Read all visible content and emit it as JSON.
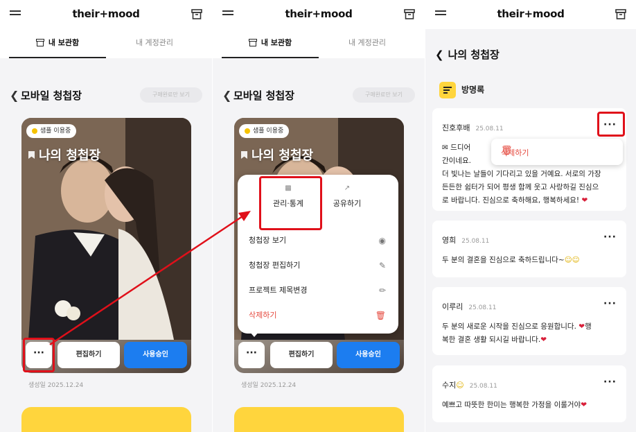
{
  "app": {
    "logo": "their+mood"
  },
  "tabs": {
    "archive": "내 보관함",
    "account": "내 계정관리"
  },
  "list_page": {
    "title": "모바일 청첩장",
    "purchased_toggle": "구매완료만 보기",
    "card": {
      "badge": "샘플 이용중",
      "title": "나의 청첩장",
      "more_label": "···",
      "edit_label": "편집하기",
      "approve_label": "사용승인"
    },
    "created_date": "생성일 2025.12.24"
  },
  "menu": {
    "stats_label": "관리·통계",
    "share_label": "공유하기",
    "items": [
      {
        "label": "청첩장 보기",
        "icon": "eye-icon"
      },
      {
        "label": "청첩장 편집하기",
        "icon": "edit-doc-icon"
      },
      {
        "label": "프로젝트 제목변경",
        "icon": "pencil-icon"
      },
      {
        "label": "삭제하기",
        "icon": "trash-icon"
      }
    ]
  },
  "guestbook_page": {
    "title": "나의 청첩장",
    "section_title": "방명록",
    "delete_popup": "삭제하기",
    "entries": [
      {
        "name": "진호후배",
        "date": "25.08.11",
        "line1": "드디어 ",
        "line2": "간이네요. ",
        "line3": "더 빛나는 날들이 기다리고 있을 거예요. 서로의 가장",
        "line4": "든든한 쉼터가 되어 평생 함께 웃고 사랑하길 진심으",
        "line5": "로 바랍니다. 진심으로 축하해요, 행복하세요!"
      },
      {
        "name": "영희",
        "date": "25.08.11",
        "text": "두 분의 결혼을 진심으로 축하드립니다~"
      },
      {
        "name": "이루리",
        "date": "25.08.11",
        "line1": "두 분의 새로운 시작을 진심으로 응원합니다. ",
        "line1b": "행",
        "line2": "복한 결혼 생활 되시길 바랍니다."
      },
      {
        "name": "수지",
        "date": "25.08.11",
        "text": "예쁘고 따뜻한 한미는 행복한 가정을 이룰거야"
      }
    ]
  },
  "colors": {
    "accent_blue": "#1c7df0",
    "brand_yellow": "#ffd53d",
    "highlight_red": "#e0101a",
    "delete_red": "#e5483d"
  }
}
